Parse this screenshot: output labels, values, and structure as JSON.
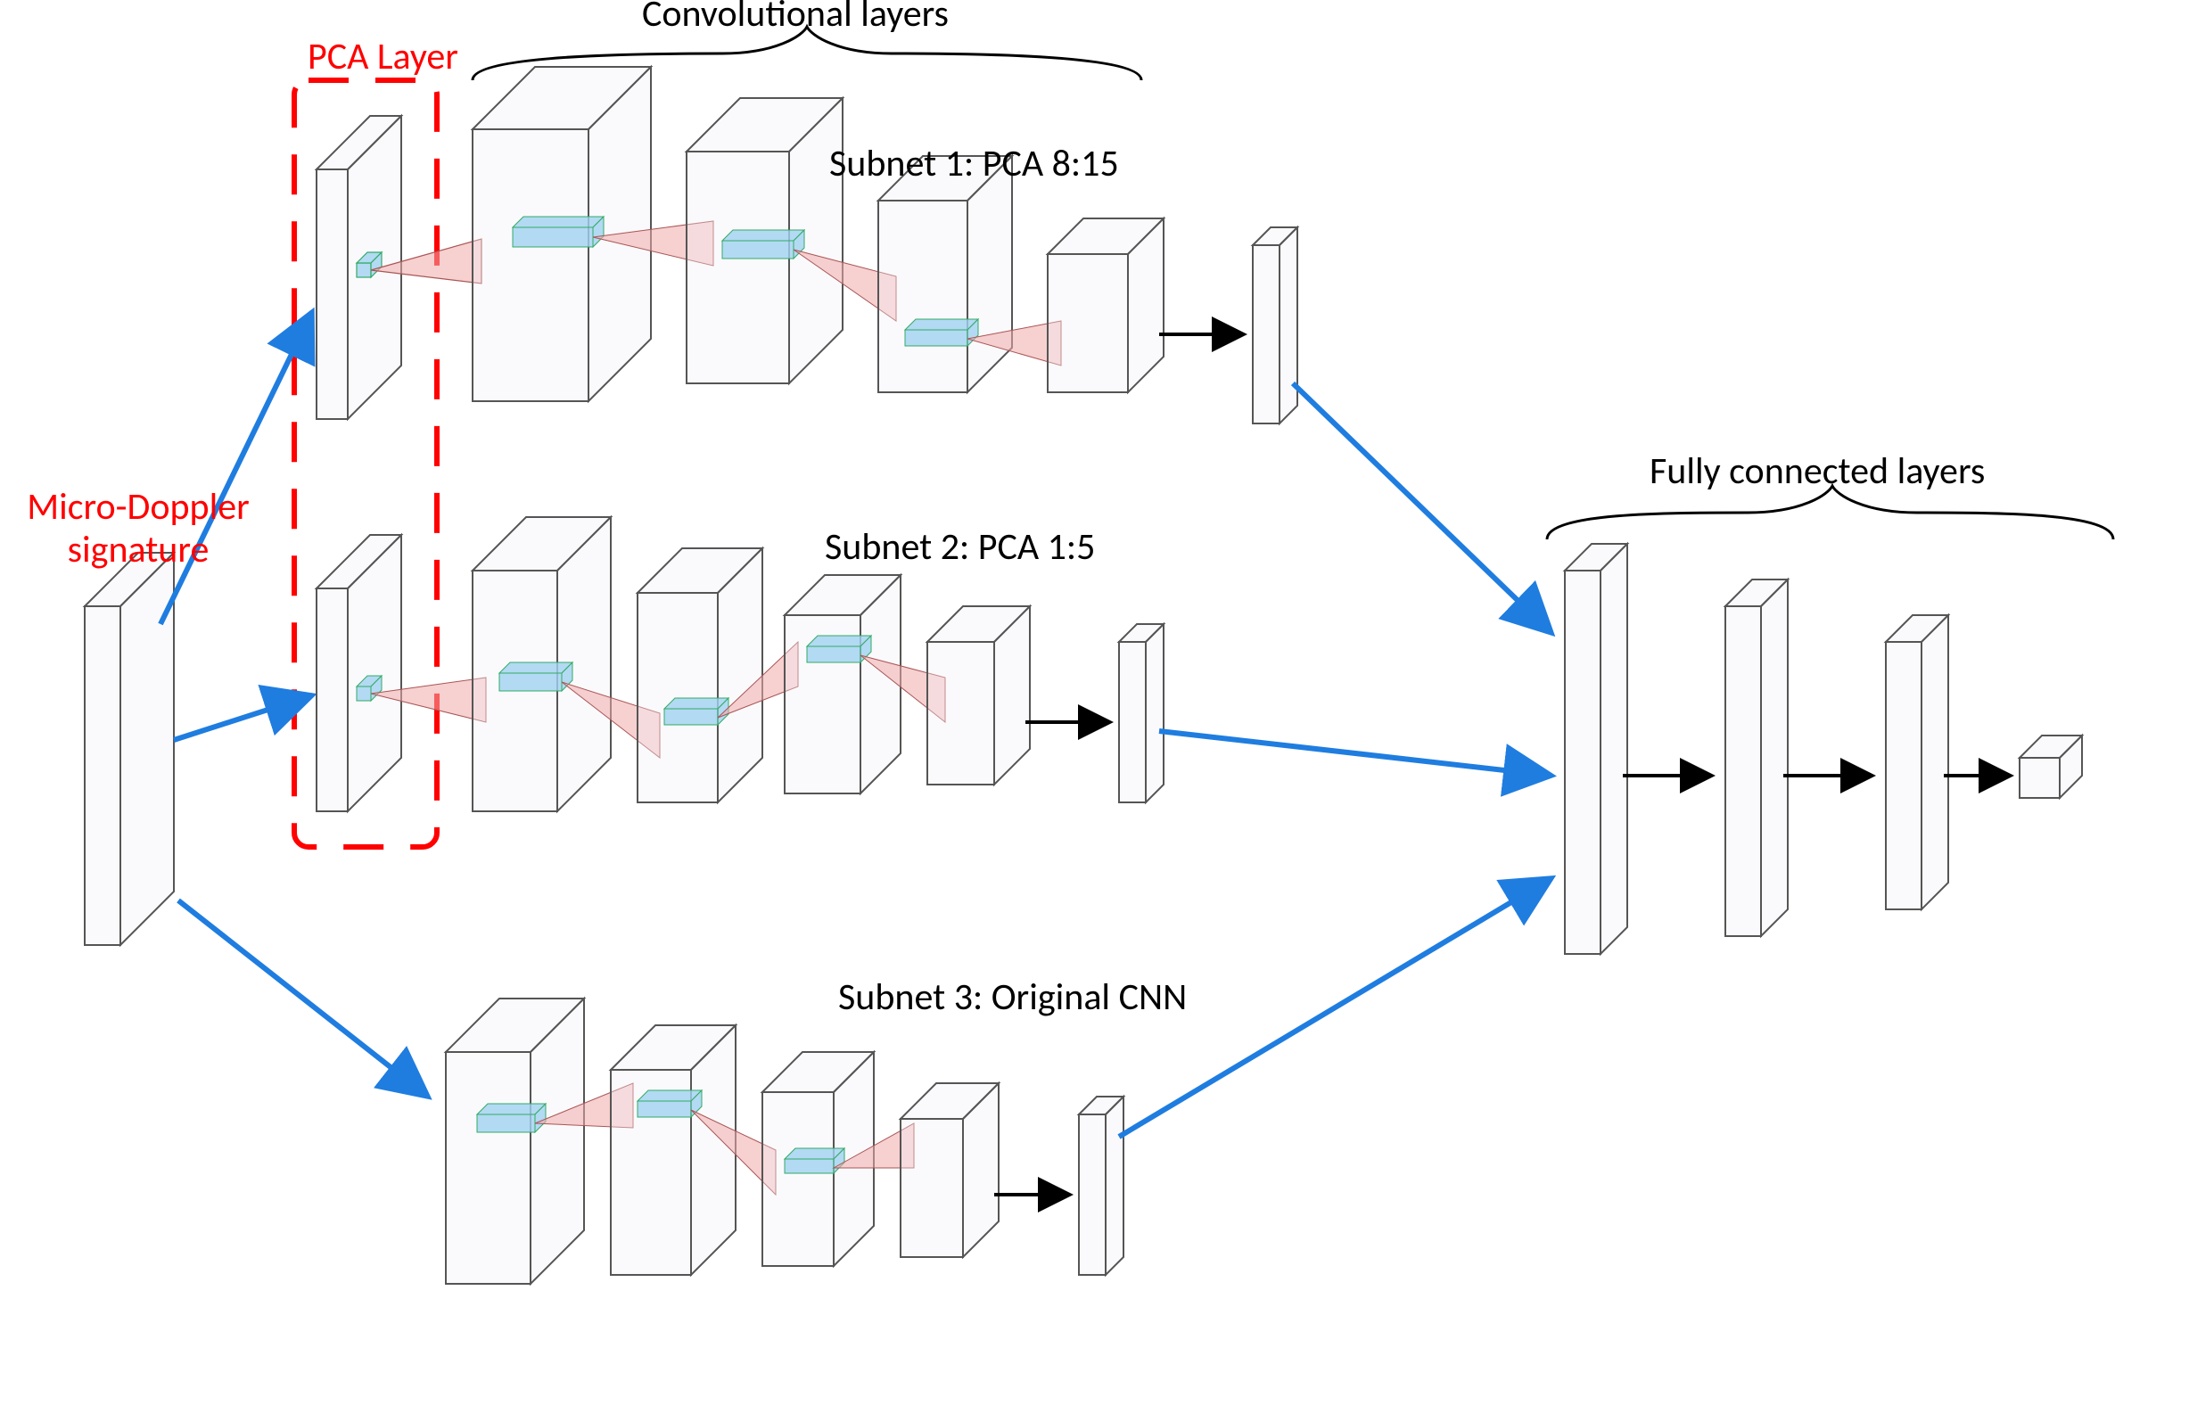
{
  "labels": {
    "micro_doppler": "Micro-Doppler\nsignature",
    "pca_layer": "PCA Layer",
    "conv_layers": "Convolutional layers",
    "subnet1": "Subnet 1: PCA 8:15",
    "subnet2": "Subnet 2: PCA 1:5",
    "subnet3": "Subnet 3: Original CNN",
    "fc_layers": "Fully connected layers"
  },
  "colors": {
    "red": "#ff0000",
    "blue": "#1f7de0",
    "stroke": "#444",
    "fill": "rgba(240,240,245,0.35)",
    "filterBlue": "rgba(160,210,240,0.7)",
    "filterPink": "rgba(240,170,170,0.55)"
  },
  "structure": {
    "input": "micro_doppler_signature_slab",
    "subnet1": {
      "pca": true,
      "conv_blocks": 4,
      "fc_bar": true
    },
    "subnet2": {
      "pca": true,
      "conv_blocks": 4,
      "fc_bar": true
    },
    "subnet3": {
      "pca": false,
      "conv_blocks": 4,
      "fc_bar": true
    },
    "shared_fc": {
      "bars": 3,
      "output_cube": true
    }
  }
}
